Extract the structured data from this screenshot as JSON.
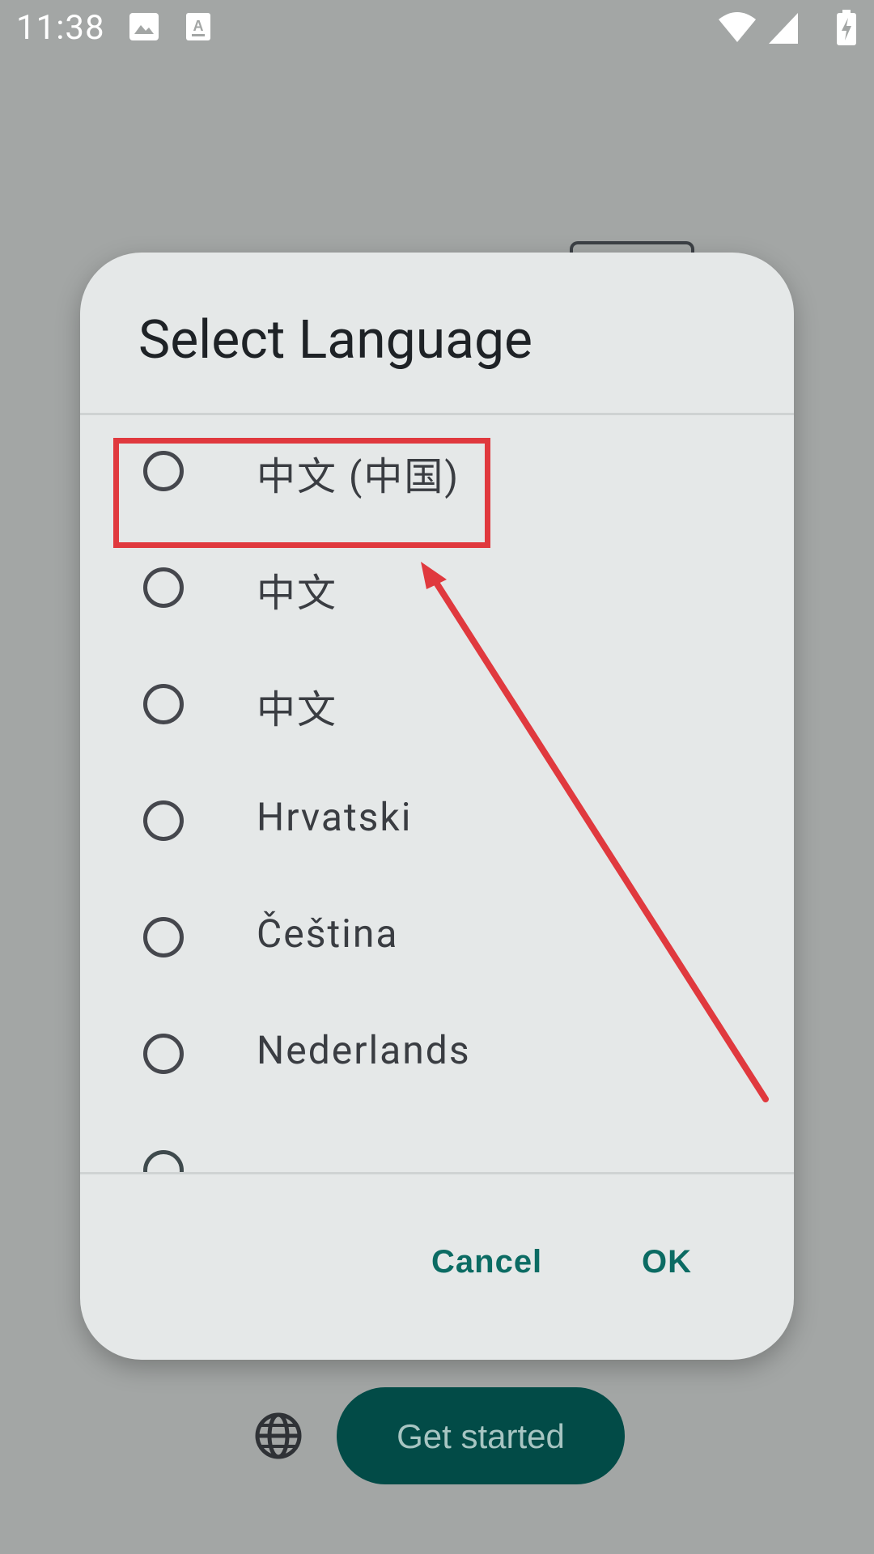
{
  "status_bar": {
    "time": "11:38",
    "left_icons": [
      "photo-icon",
      "font-icon"
    ],
    "right_icons": [
      "wifi-icon",
      "signal-icon",
      "battery-charging-icon"
    ]
  },
  "dialog": {
    "title": "Select Language",
    "languages": [
      {
        "label": "中文 (中国)",
        "selected": false
      },
      {
        "label": "中文",
        "selected": false
      },
      {
        "label": "中文",
        "selected": false
      },
      {
        "label": "Hrvatski",
        "selected": false
      },
      {
        "label": "Čeština",
        "selected": false
      },
      {
        "label": "Nederlands",
        "selected": false
      }
    ],
    "cancel_label": "Cancel",
    "ok_label": "OK"
  },
  "footer": {
    "globe_icon": "globe-icon",
    "get_started_label": "Get started"
  },
  "annotation": {
    "color": "#e0393e",
    "highlight_target": "中文 (中国)"
  },
  "colors": {
    "accent": "#0b6b63",
    "primary_button": "#024b47",
    "scrim": "#a3a6a5",
    "dialog_bg": "#e5e8e8"
  }
}
